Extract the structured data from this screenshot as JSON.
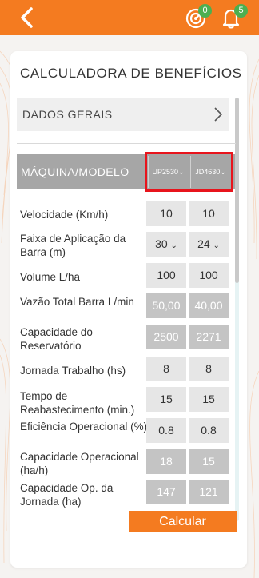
{
  "header": {
    "back_icon": "chevron-left-icon",
    "target_icon": "target-icon",
    "target_badge": "0",
    "bell_icon": "bell-icon",
    "bell_badge": "5",
    "bar_color": "#f47b20",
    "badge_color": "#4caf50"
  },
  "card": {
    "title": "CALCULADORA DE BENEFÍCIOS",
    "dados_gerais": "DADOS GERAIS",
    "maquina_modelo": "MÁQUINA/MODELO",
    "model_1": "UP2530",
    "model_2": "JD4630",
    "select_arrow": "⌄"
  },
  "rows": [
    {
      "label": "Velocidade (Km/h)",
      "v1": "10",
      "v2": "10"
    },
    {
      "label": "Faixa de Aplicação da Barra (m)",
      "v1": "30",
      "v2": "24"
    },
    {
      "label": "Volume L/ha",
      "v1": "100",
      "v2": "100"
    },
    {
      "label": "Vazão Total Barra L/min",
      "v1": "50,00",
      "v2": "40,00"
    },
    {
      "label": "Capacidade do Reservatório",
      "v1": "2500",
      "v2": "2271"
    },
    {
      "label": "Jornada Trabalho (hs)",
      "v1": "8",
      "v2": "8"
    },
    {
      "label": "Tempo de Reabastecimento (min.)",
      "v1": "15",
      "v2": "15"
    },
    {
      "label": "Eficiência Operacional (%)",
      "v1": "0.8",
      "v2": "0.8"
    },
    {
      "label": "Capacidade Operacional (ha/h)",
      "v1": "18",
      "v2": "15"
    },
    {
      "label": "Capacidade Op. da Jornada (ha)",
      "v1": "147",
      "v2": "121"
    }
  ],
  "actions": {
    "calcular": "Calcular"
  }
}
